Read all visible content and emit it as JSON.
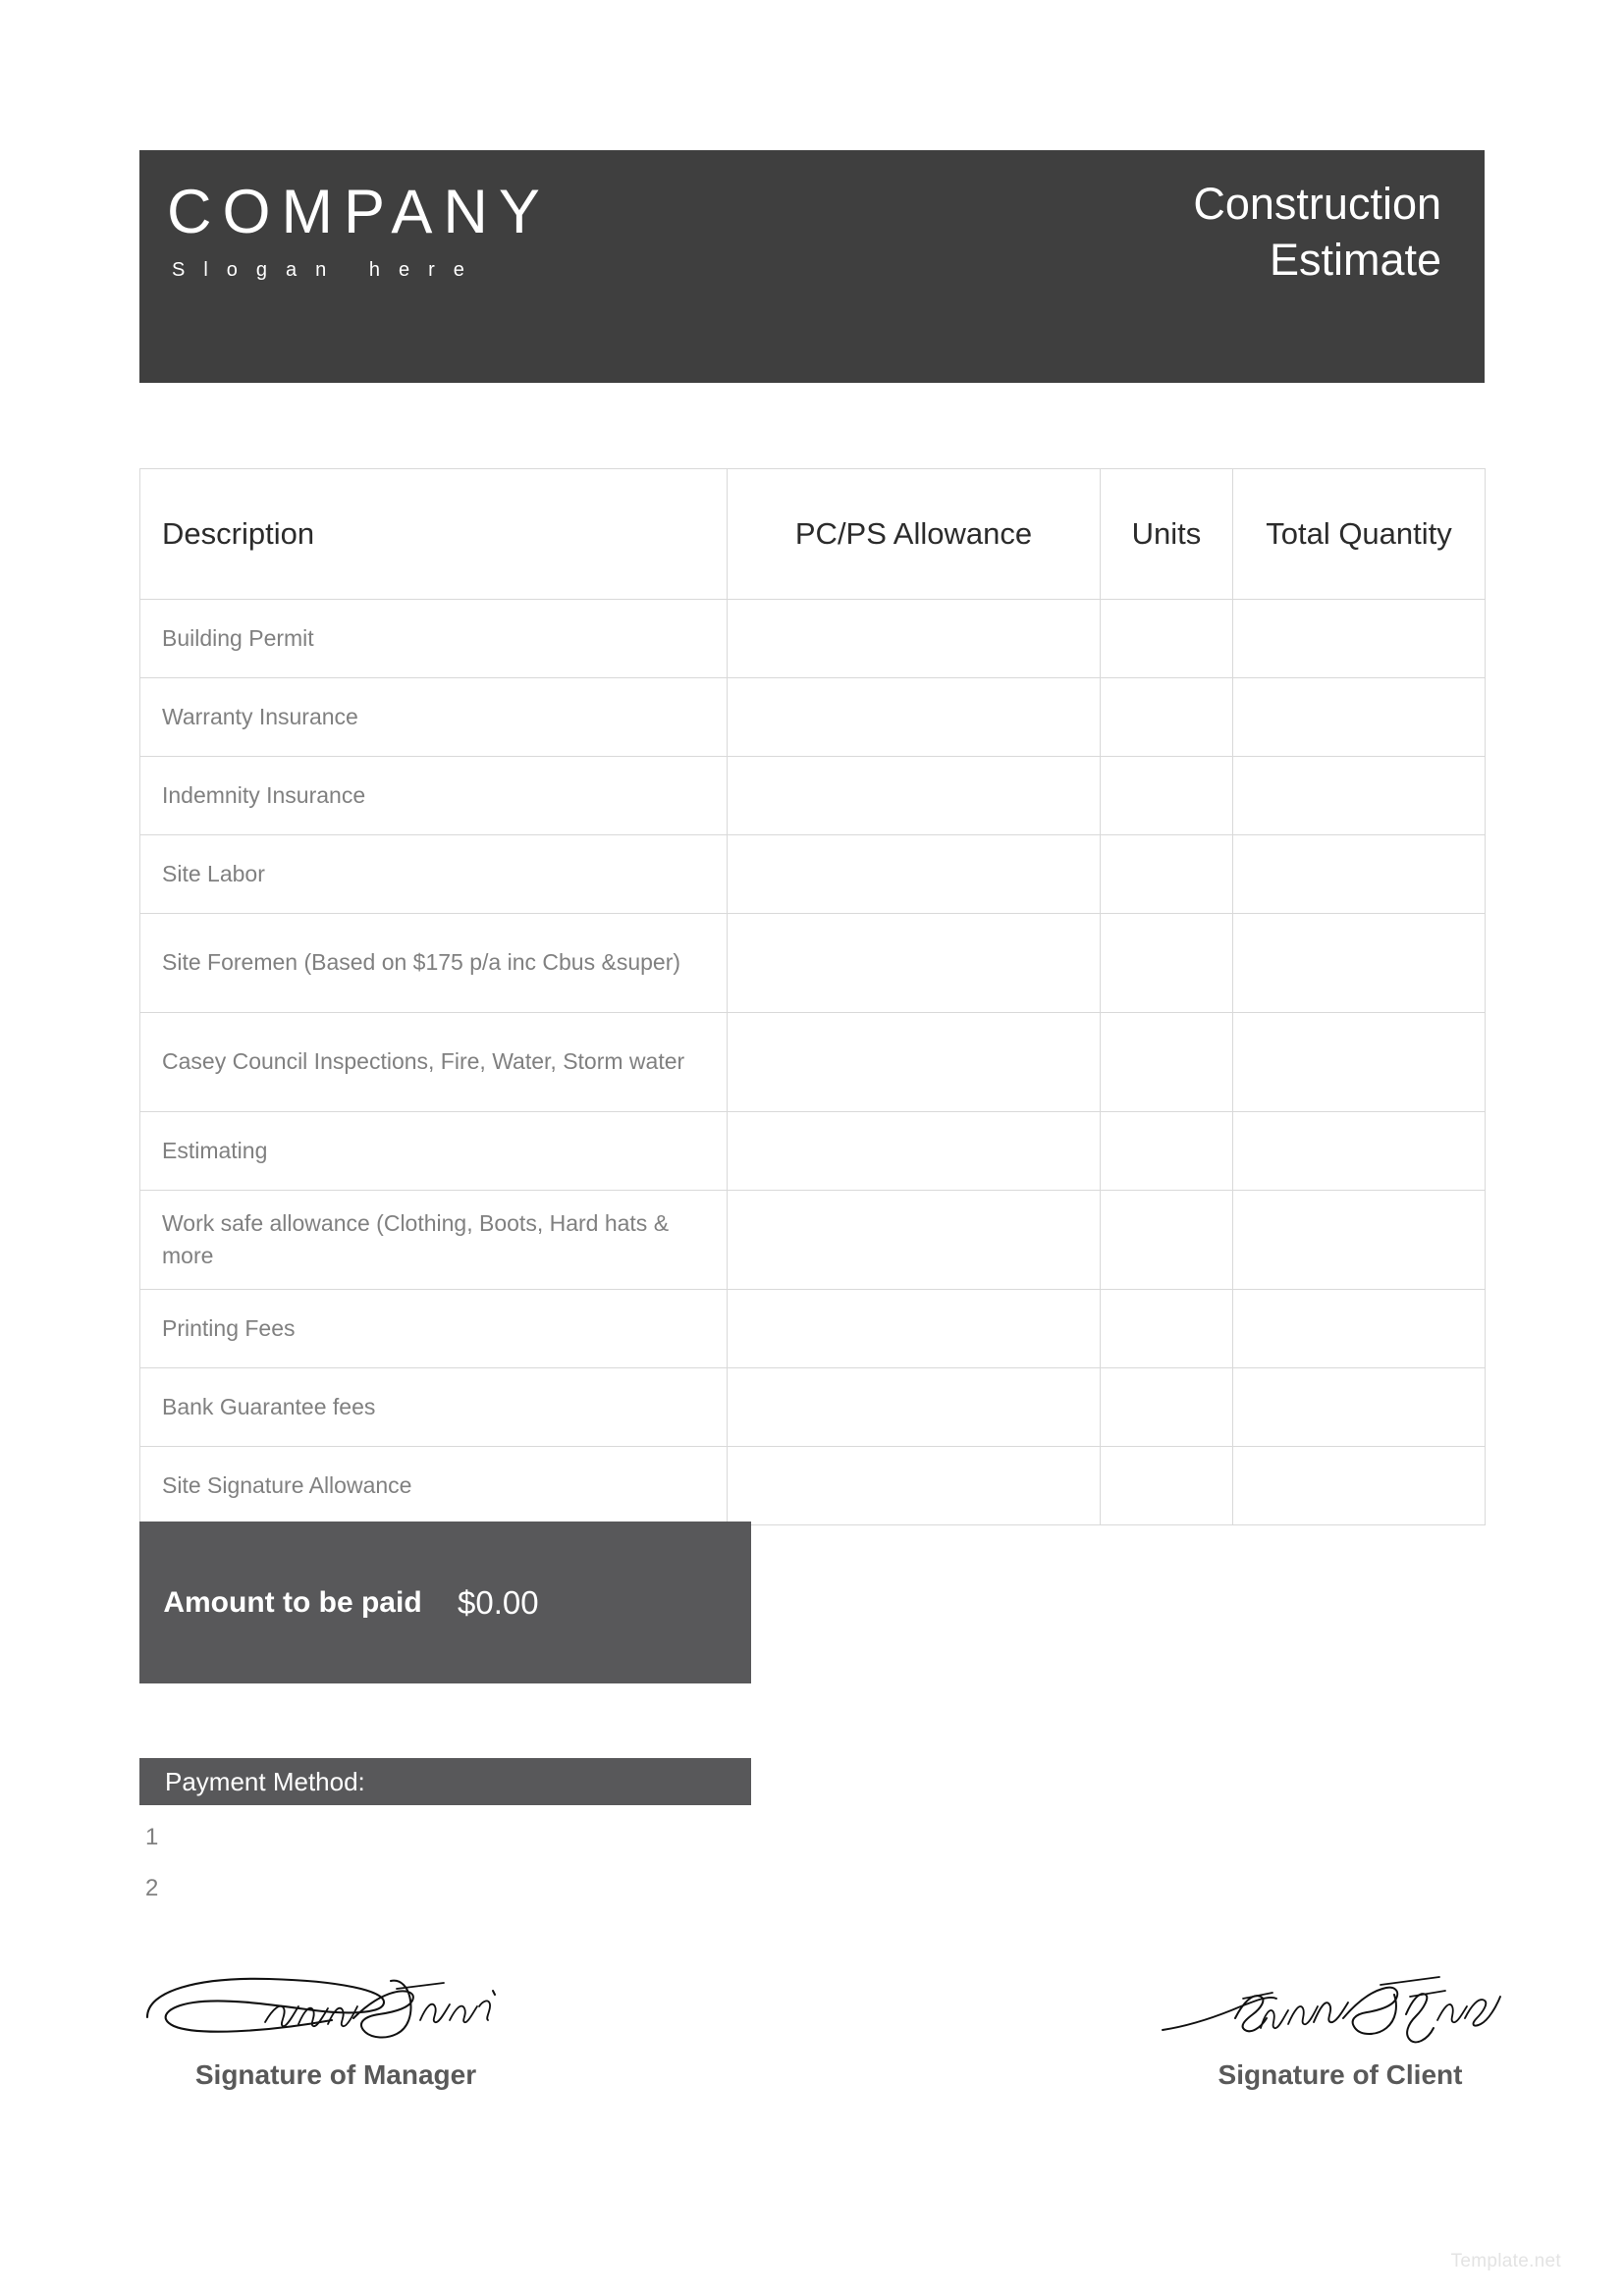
{
  "header": {
    "company_name": "COMPANY",
    "slogan": "Slogan here",
    "doc_title_line1": "Construction",
    "doc_title_line2": "Estimate",
    "background_color": "#3f3f3f"
  },
  "table": {
    "columns": [
      "Description",
      "PC/PS Allowance",
      "Units",
      "Total Quantity"
    ],
    "rows": [
      {
        "description": "Building Permit",
        "allowance": "",
        "units": "",
        "total_quantity": ""
      },
      {
        "description": "Warranty Insurance",
        "allowance": "",
        "units": "",
        "total_quantity": ""
      },
      {
        "description": "Indemnity Insurance",
        "allowance": "",
        "units": "",
        "total_quantity": ""
      },
      {
        "description": "Site Labor",
        "allowance": "",
        "units": "",
        "total_quantity": ""
      },
      {
        "description": "Site Foremen (Based on $175 p/a inc Cbus &super)",
        "allowance": "",
        "units": "",
        "total_quantity": ""
      },
      {
        "description": "Casey Council Inspections, Fire, Water, Storm water",
        "allowance": "",
        "units": "",
        "total_quantity": ""
      },
      {
        "description": "Estimating",
        "allowance": "",
        "units": "",
        "total_quantity": ""
      },
      {
        "description": "Work safe allowance (Clothing, Boots, Hard hats & more",
        "allowance": "",
        "units": "",
        "total_quantity": ""
      },
      {
        "description": "Printing Fees",
        "allowance": "",
        "units": "",
        "total_quantity": ""
      },
      {
        "description": "Bank Guarantee fees",
        "allowance": "",
        "units": "",
        "total_quantity": ""
      },
      {
        "description": "Site Signature Allowance",
        "allowance": "",
        "units": "",
        "total_quantity": ""
      }
    ]
  },
  "amount": {
    "label": "Amount to be paid",
    "value": "$0.00",
    "background_color": "#58585a"
  },
  "payment_method": {
    "title": "Payment Method:",
    "items": [
      "1",
      "2"
    ],
    "background_color": "#58585a"
  },
  "signatures": {
    "manager_caption": "Signature of Manager",
    "manager_signature": "handwritten-signature",
    "client_caption": "Signature of Client",
    "client_signature": "handwritten-signature"
  },
  "footer": {
    "watermark": "Template.net"
  }
}
